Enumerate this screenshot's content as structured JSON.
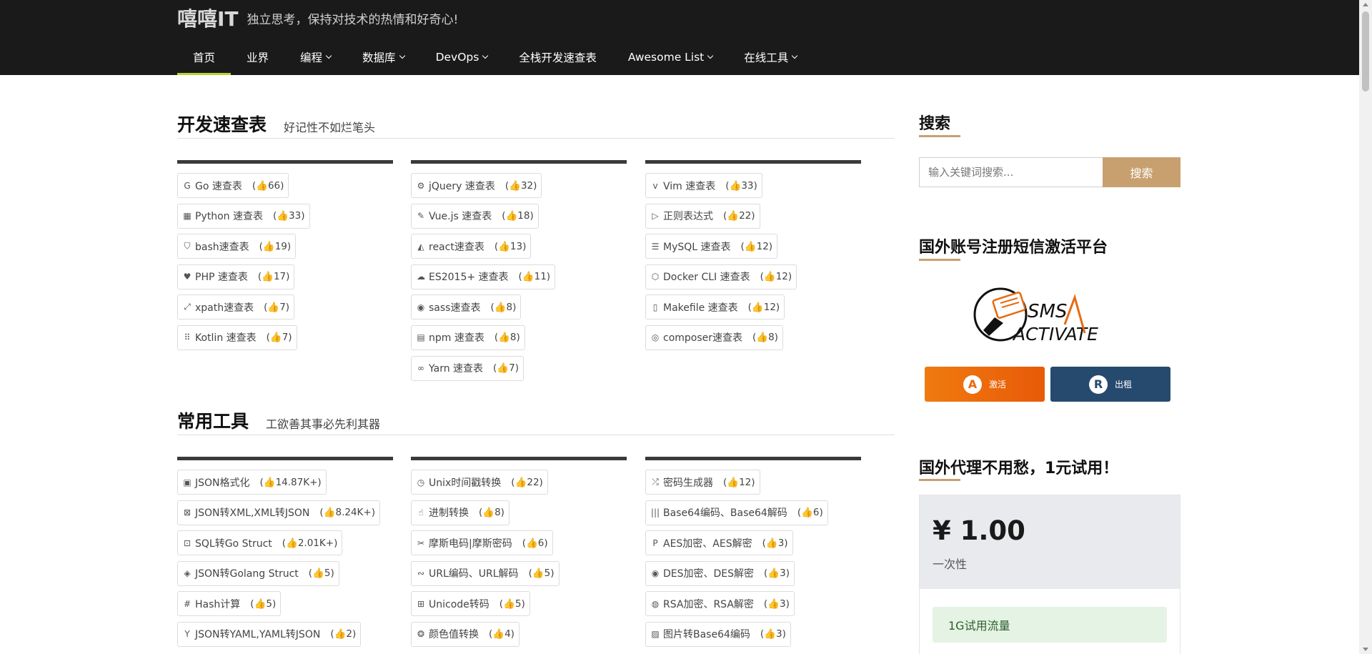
{
  "brand": {
    "name": "嘻嘻IT",
    "slogan": "独立思考，保持对技术的热情和好奇心!"
  },
  "nav": [
    {
      "label": "首页",
      "active": true,
      "dropdown": false
    },
    {
      "label": "业界",
      "active": false,
      "dropdown": false
    },
    {
      "label": "编程",
      "active": false,
      "dropdown": true
    },
    {
      "label": "数据库",
      "active": false,
      "dropdown": true
    },
    {
      "label": "DevOps",
      "active": false,
      "dropdown": true
    },
    {
      "label": "全栈开发速查表",
      "active": false,
      "dropdown": false
    },
    {
      "label": "Awesome List",
      "active": false,
      "dropdown": true
    },
    {
      "label": "在线工具",
      "active": false,
      "dropdown": true
    }
  ],
  "cheatsheets": {
    "title": "开发速查表",
    "subtitle": "好记性不如烂笔头",
    "columns": [
      [
        {
          "icon": "google-icon",
          "glyph": "G",
          "label": "Go 速查表",
          "count": "(👍66)"
        },
        {
          "icon": "windows-icon",
          "glyph": "▦",
          "label": "Python 速查表",
          "count": "(👍33)"
        },
        {
          "icon": "shirt-icon",
          "glyph": "⛉",
          "label": "bash速查表",
          "count": "(👍19)"
        },
        {
          "icon": "heart-icon",
          "glyph": "♥",
          "label": "PHP 速查表",
          "count": "(👍17)"
        },
        {
          "icon": "expand-icon",
          "glyph": "⤢",
          "label": "xpath速查表",
          "count": "(👍7)"
        },
        {
          "icon": "grid-icon",
          "glyph": "⠿",
          "label": "Kotlin 速查表",
          "count": "(👍7)"
        }
      ],
      [
        {
          "icon": "gear-icon",
          "glyph": "⚙",
          "label": "jQuery 速查表",
          "count": "(👍32)"
        },
        {
          "icon": "pencil-icon",
          "glyph": "✎",
          "label": "Vue.js 速查表",
          "count": "(👍18)"
        },
        {
          "icon": "area-chart-icon",
          "glyph": "◭",
          "label": "react速查表",
          "count": "(👍13)"
        },
        {
          "icon": "cloud-icon",
          "glyph": "☁",
          "label": "ES2015+ 速查表",
          "count": "(👍11)"
        },
        {
          "icon": "compass-icon",
          "glyph": "◉",
          "label": "sass速查表",
          "count": "(👍8)"
        },
        {
          "icon": "book-icon",
          "glyph": "▤",
          "label": "npm 速查表",
          "count": "(👍8)"
        },
        {
          "icon": "link-icon",
          "glyph": "∞",
          "label": "Yarn 速查表",
          "count": "(👍7)"
        }
      ],
      [
        {
          "icon": "vimeo-icon",
          "glyph": "v",
          "label": "Vim 速查表",
          "count": "(👍33)"
        },
        {
          "icon": "play-circle-icon",
          "glyph": "▷",
          "label": "正则表达式",
          "count": "(👍22)"
        },
        {
          "icon": "database-icon",
          "glyph": "☰",
          "label": "MySQL 速查表",
          "count": "(👍12)"
        },
        {
          "icon": "docker-icon",
          "glyph": "⬡",
          "label": "Docker CLI 速查表",
          "count": "(👍12)"
        },
        {
          "icon": "file-icon",
          "glyph": "▯",
          "label": "Makefile 速查表",
          "count": "(👍12)"
        },
        {
          "icon": "composer-icon",
          "glyph": "◎",
          "label": "composer速查表",
          "count": "(👍8)"
        }
      ]
    ]
  },
  "tools": {
    "title": "常用工具",
    "subtitle": "工欲善其事必先利其器",
    "columns": [
      [
        {
          "icon": "file-code-icon",
          "glyph": "▣",
          "label": "JSON格式化",
          "count": "(👍14.87K+)"
        },
        {
          "icon": "file-excel-icon",
          "glyph": "⊠",
          "label": "JSON转XML,XML转JSON",
          "count": "(👍8.24K+)"
        },
        {
          "icon": "database-box-icon",
          "glyph": "⊡",
          "label": "SQL转Go Struct",
          "count": "(👍2.01K+)"
        },
        {
          "icon": "cube-icon",
          "glyph": "◈",
          "label": "JSON转Golang Struct",
          "count": "(👍5)"
        },
        {
          "icon": "hash-icon",
          "glyph": "#",
          "label": "Hash计算",
          "count": "(👍5)"
        },
        {
          "icon": "y-icon",
          "glyph": "Y",
          "label": "JSON转YAML,YAML转JSON",
          "count": "(👍2)"
        }
      ],
      [
        {
          "icon": "clock-icon",
          "glyph": "◷",
          "label": "Unix时间戳转换",
          "count": "(👍22)"
        },
        {
          "icon": "hand-icon",
          "glyph": "☝",
          "label": "进制转换",
          "count": "(👍8)"
        },
        {
          "icon": "tools-icon",
          "glyph": "✂",
          "label": "摩斯电码|摩斯密码",
          "count": "(👍6)"
        },
        {
          "icon": "link-chain-icon",
          "glyph": "∾",
          "label": "URL编码、URL解码",
          "count": "(👍5)"
        },
        {
          "icon": "unicode-icon",
          "glyph": "⊞",
          "label": "Unicode转码",
          "count": "(👍5)"
        },
        {
          "icon": "palette-icon",
          "glyph": "❂",
          "label": "颜色值转换",
          "count": "(👍4)"
        }
      ],
      [
        {
          "icon": "random-icon",
          "glyph": "⤮",
          "label": "密码生成器",
          "count": "(👍12)"
        },
        {
          "icon": "barcode-icon",
          "glyph": "|||",
          "label": "Base64编码、Base64解码",
          "count": "(👍6)"
        },
        {
          "icon": "paypal-icon",
          "glyph": "P",
          "label": "AES加密、AES解密",
          "count": "(👍3)"
        },
        {
          "icon": "disc-icon",
          "glyph": "◉",
          "label": "DES加密、DES解密",
          "count": "(👍3)"
        },
        {
          "icon": "key-circle-icon",
          "glyph": "◍",
          "label": "RSA加密、RSA解密",
          "count": "(👍3)"
        },
        {
          "icon": "image-icon",
          "glyph": "▨",
          "label": "图片转Base64编码",
          "count": "(👍3)"
        }
      ]
    ]
  },
  "sidebar": {
    "search": {
      "title": "搜索",
      "placeholder": "输入关键词搜索...",
      "button": "搜索"
    },
    "sms": {
      "title": "国外账号注册短信激活平台",
      "logo_line1": "SMS",
      "logo_line2": "ACTIVATE",
      "activate_label": "激活",
      "activate_badge": "A",
      "rent_label": "出租",
      "rent_badge": "R",
      "activate_color": "#f07a10",
      "rent_color": "#264a6e"
    },
    "proxy": {
      "title": "国外代理不用愁，1元试用！",
      "price": "¥ 1.00",
      "period": "一次性",
      "feature": "1G试用流量"
    }
  },
  "colors": {
    "header_bg": "#1a1a1a",
    "nav_active": "#b8d430",
    "accent": "#c8a070"
  }
}
